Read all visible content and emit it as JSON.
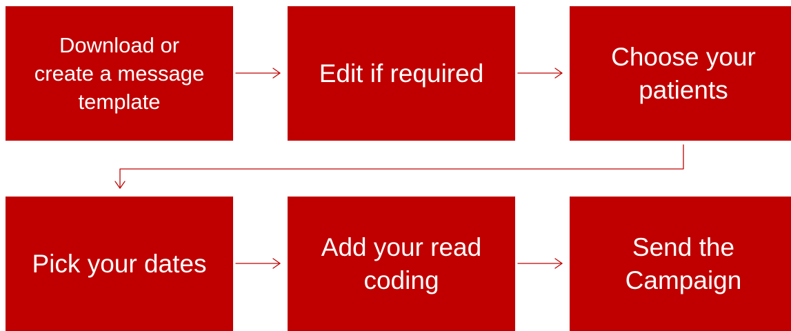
{
  "accent_color": "#c00000",
  "steps": [
    {
      "label": "Download or\ncreate a message\ntemplate"
    },
    {
      "label": "Edit if required"
    },
    {
      "label": "Choose your\npatients"
    },
    {
      "label": "Pick your dates"
    },
    {
      "label": "Add your read\ncoding"
    },
    {
      "label": "Send the\nCampaign"
    }
  ],
  "connectors": [
    {
      "from": "step-1",
      "to": "step-2",
      "icon": "arrow-right-icon"
    },
    {
      "from": "step-2",
      "to": "step-3",
      "icon": "arrow-right-icon"
    },
    {
      "from": "step-3",
      "to": "step-4",
      "icon": "elbow-arrow-down-icon"
    },
    {
      "from": "step-4",
      "to": "step-5",
      "icon": "arrow-right-icon"
    },
    {
      "from": "step-5",
      "to": "step-6",
      "icon": "arrow-right-icon"
    }
  ]
}
